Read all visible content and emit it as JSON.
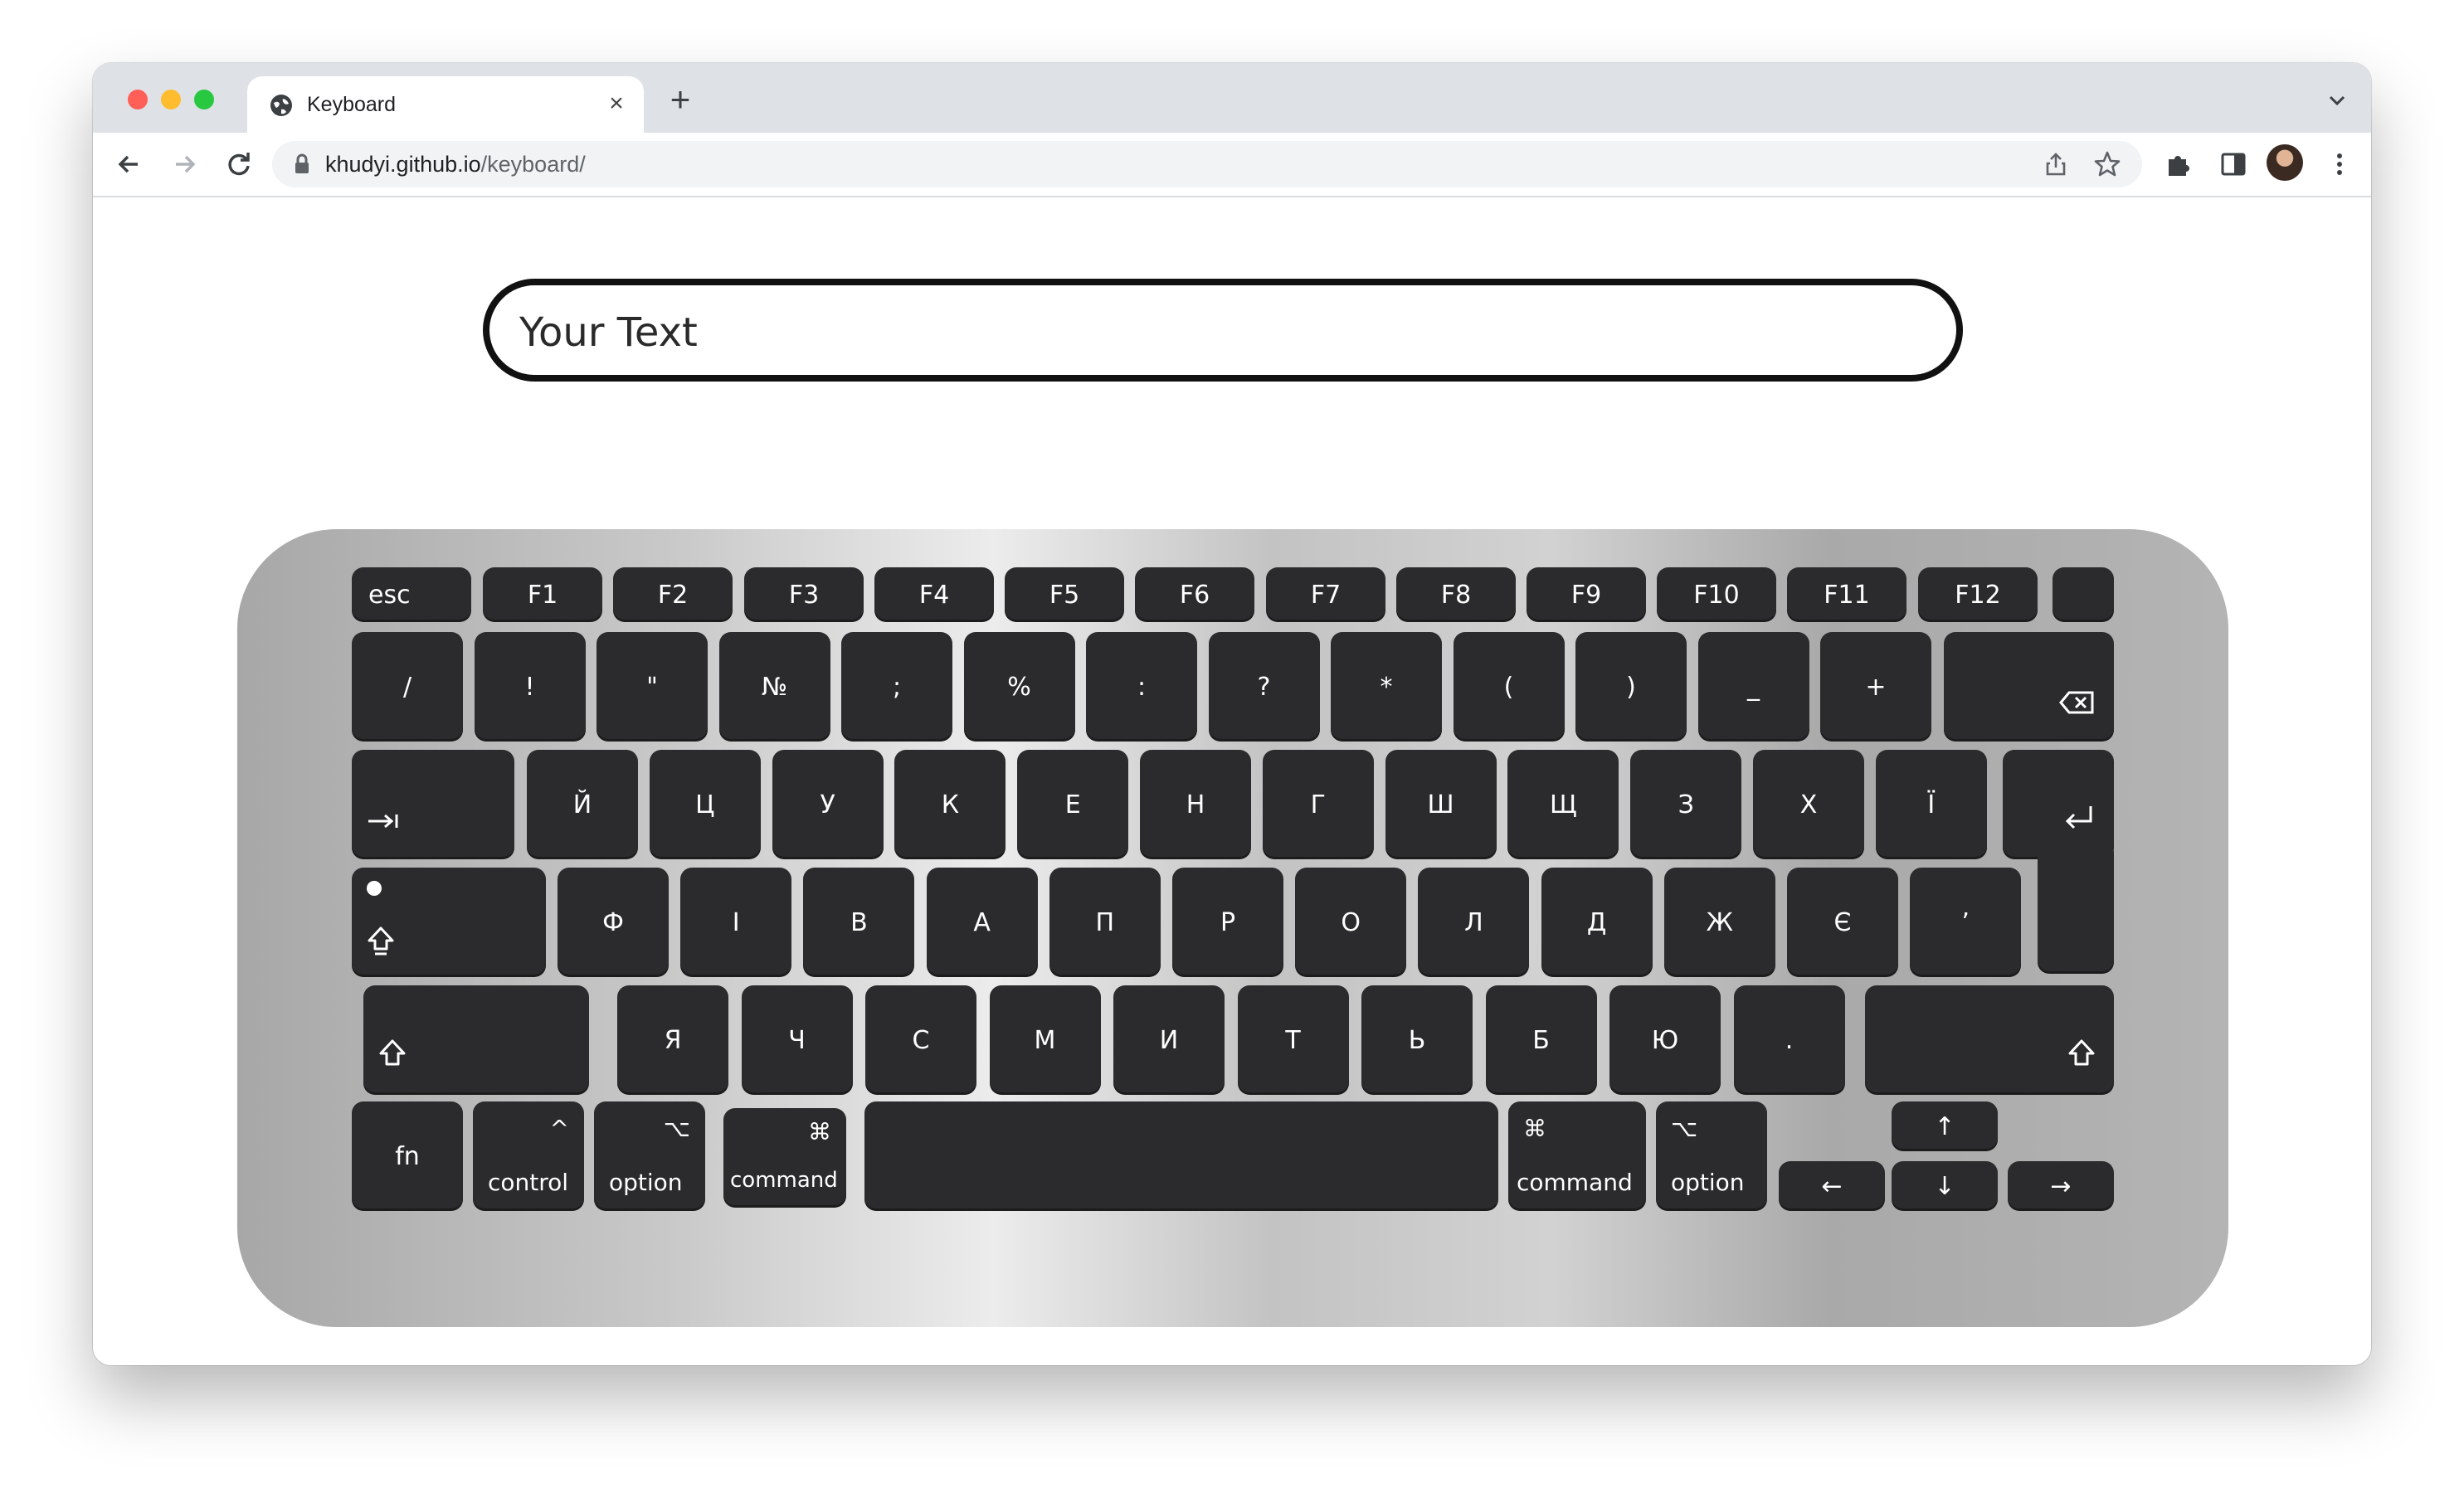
{
  "browser": {
    "tab_title": "Keyboard",
    "tab_close": "×",
    "new_tab": "+",
    "url_host": "khudyi.github.io",
    "url_path": "/keyboard/"
  },
  "page": {
    "input_placeholder": "Your Text"
  },
  "keyboard": {
    "fn_row": [
      "esc",
      "F1",
      "F2",
      "F3",
      "F4",
      "F5",
      "F6",
      "F7",
      "F8",
      "F9",
      "F10",
      "F11",
      "F12",
      ""
    ],
    "num_row": [
      "/",
      "!",
      "\"",
      "№",
      ";",
      "%",
      ":",
      "?",
      "*",
      "(",
      ")",
      "_",
      "+"
    ],
    "top_row": [
      "Й",
      "Ц",
      "У",
      "К",
      "Е",
      "Н",
      "Г",
      "Ш",
      "Щ",
      "З",
      "Х",
      "Ї"
    ],
    "home_row": [
      "Ф",
      "І",
      "В",
      "А",
      "П",
      "Р",
      "О",
      "Л",
      "Д",
      "Ж",
      "Є",
      "’"
    ],
    "bottom_row": [
      "Я",
      "Ч",
      "С",
      "М",
      "И",
      "Т",
      "Ь",
      "Б",
      "Ю",
      "."
    ],
    "mod": {
      "fn": "fn",
      "control": "control",
      "control_symbol": "^",
      "option": "option",
      "option_symbol": "⌥",
      "command": "command",
      "command_symbol": "⌘",
      "arrow_left": "←",
      "arrow_up": "↑",
      "arrow_down": "↓",
      "arrow_right": "→"
    },
    "icons": {
      "tab": "tab-icon",
      "backspace": "backspace-icon",
      "return": "return-icon",
      "capslock": "capslock-icon",
      "shift": "shift-icon"
    }
  }
}
